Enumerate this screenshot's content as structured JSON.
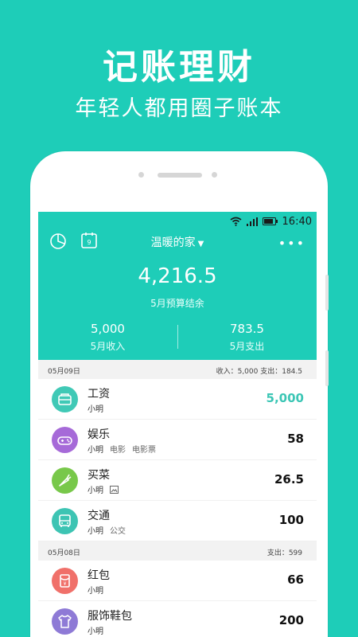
{
  "hero": {
    "title": "记账理财",
    "subtitle": "年轻人都用圈子账本"
  },
  "colors": {
    "accent": "#1ecdb8",
    "income": "#3cc6b5"
  },
  "status_bar": {
    "time": "16:40"
  },
  "header": {
    "book_name": "温暖的家",
    "caret": "▼",
    "more": "•••",
    "balance": "4,216.5",
    "balance_label": "5月预算结余",
    "income_amount": "5,000",
    "income_label": "5月收入",
    "expense_amount": "783.5",
    "expense_label": "5月支出"
  },
  "groups": [
    {
      "date": "05月09日",
      "totals": "收入：5,000  支出：184.5",
      "items": [
        {
          "name": "工资",
          "user": "小明",
          "tags": [],
          "amount": "5,000",
          "icon": "wallet-icon",
          "icon_color": "#40c9b6"
        },
        {
          "name": "娱乐",
          "user": "小明",
          "tags": [
            "电影",
            "电影票"
          ],
          "amount": "58",
          "icon": "gamepad-icon",
          "icon_color": "#a66ad8"
        },
        {
          "name": "买菜",
          "user": "小明",
          "tags": [],
          "amount": "26.5",
          "icon": "carrot-icon",
          "icon_color": "#78c84a"
        },
        {
          "name": "交通",
          "user": "小明",
          "tags": [
            "公交"
          ],
          "amount": "100",
          "icon": "bus-icon",
          "icon_color": "#3dc4b3"
        }
      ]
    },
    {
      "date": "05月08日",
      "totals": "支出：599",
      "items": [
        {
          "name": "红包",
          "user": "小明",
          "tags": [],
          "amount": "66",
          "icon": "red-envelope-icon",
          "icon_color": "#f0706a"
        },
        {
          "name": "服饰鞋包",
          "user": "小明",
          "tags": [],
          "amount": "200",
          "icon": "clothing-icon",
          "icon_color": "#8e7ad6"
        }
      ]
    }
  ]
}
